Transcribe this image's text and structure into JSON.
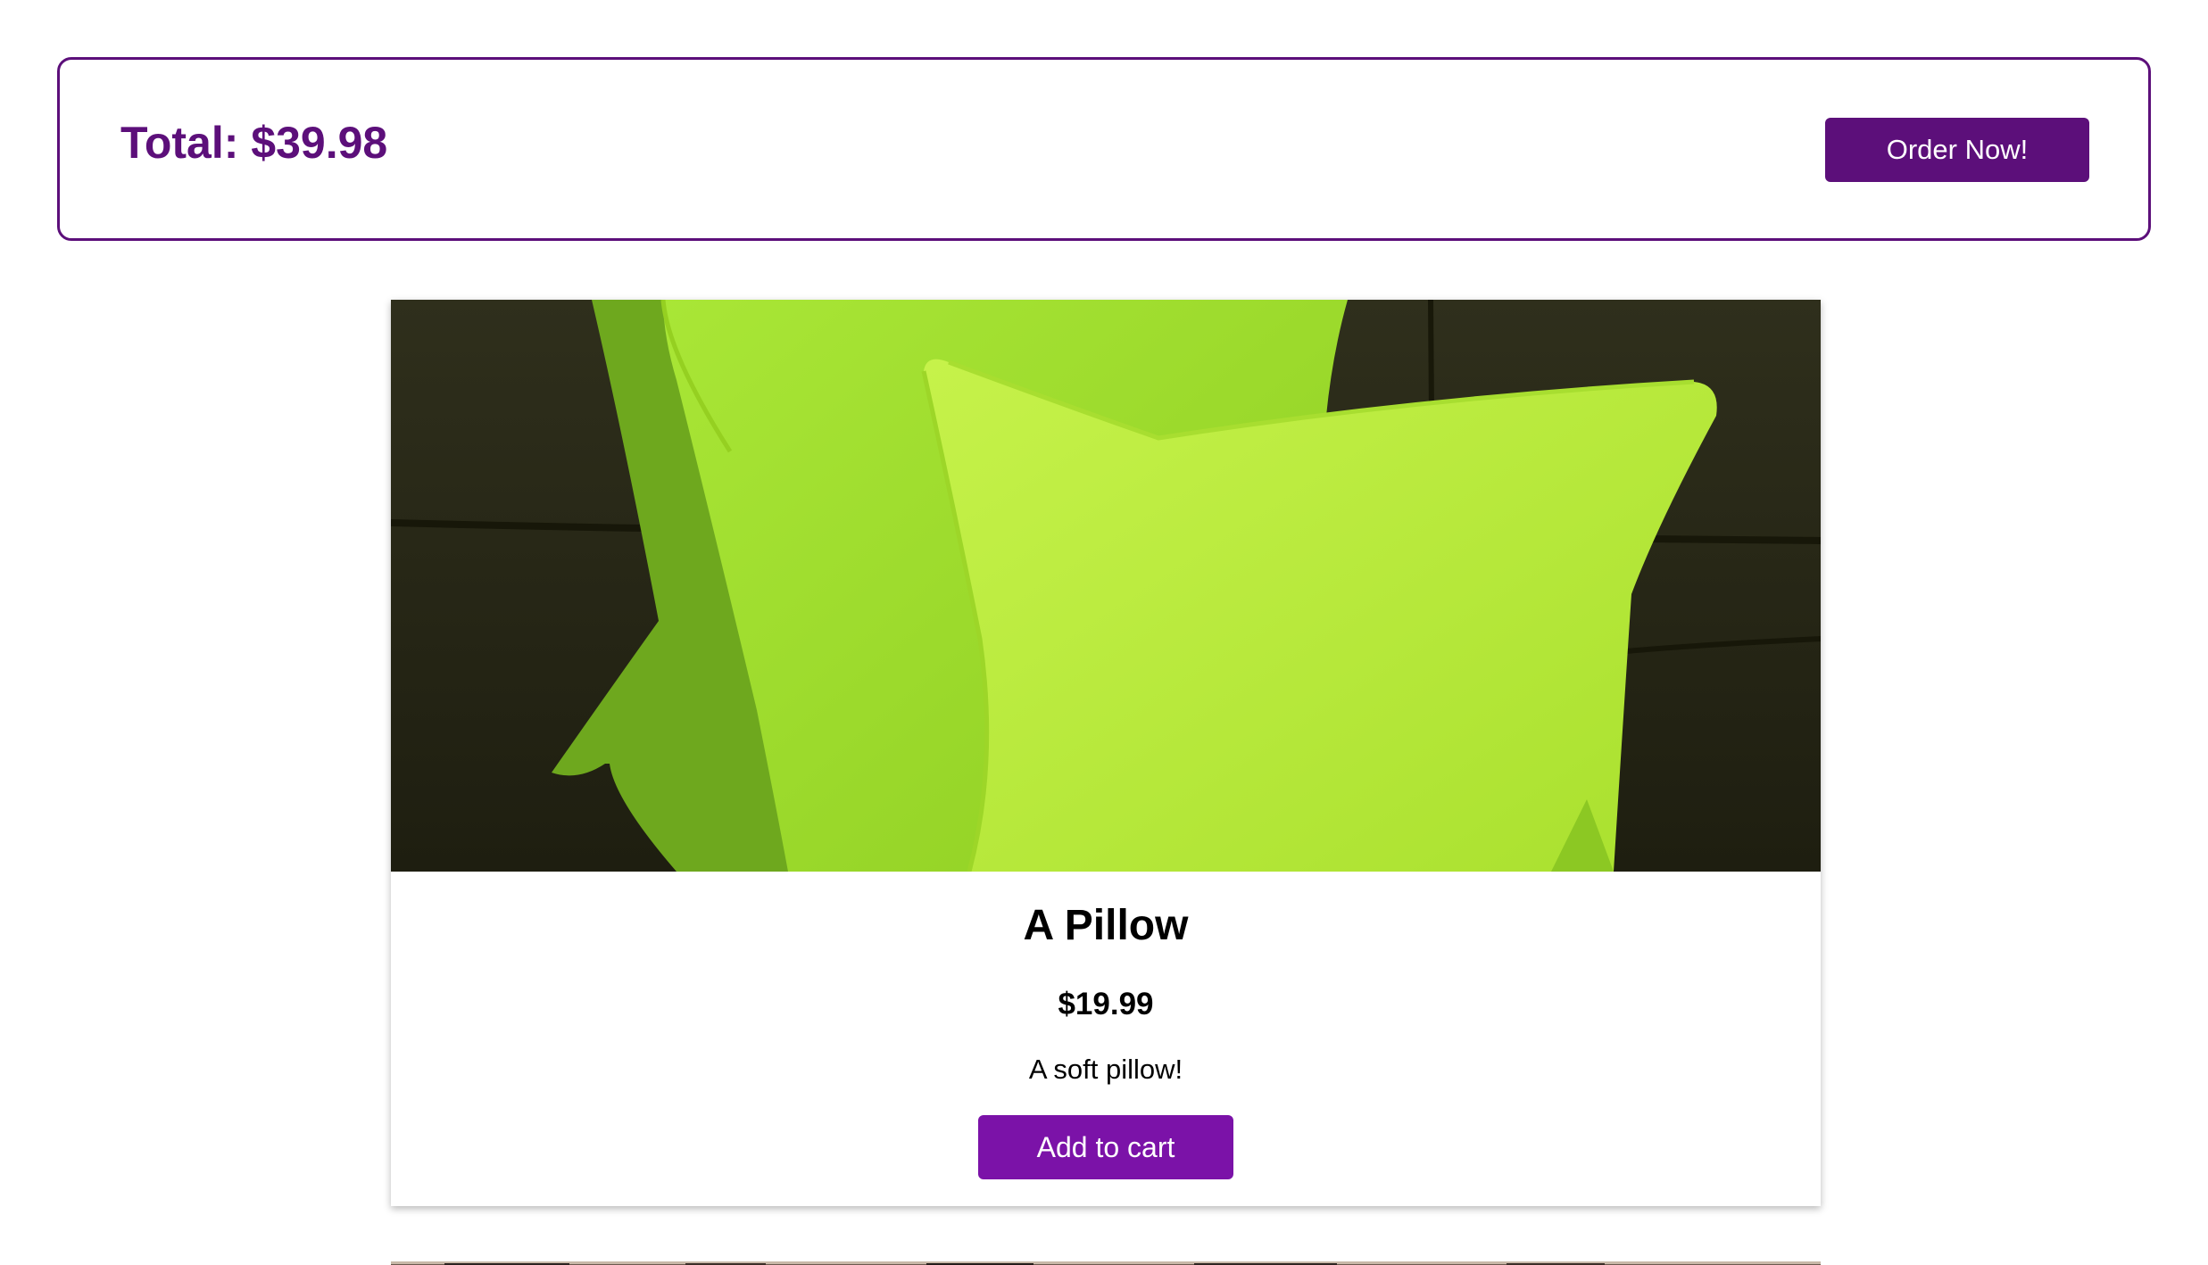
{
  "cart": {
    "total_label": "Total: $39.98",
    "order_button_label": "Order Now!"
  },
  "products": [
    {
      "title": "A Pillow",
      "price": "$19.99",
      "description": "A soft pillow!",
      "add_button_label": "Add to cart",
      "image_subject": "green-pillows-on-dark-sofa"
    }
  ],
  "colors": {
    "brand_dark_purple": "#5c0f7a",
    "button_purple": "#7b12a8",
    "pillow_green": "#b8ee3c",
    "sofa_dark": "#2a2a18"
  }
}
